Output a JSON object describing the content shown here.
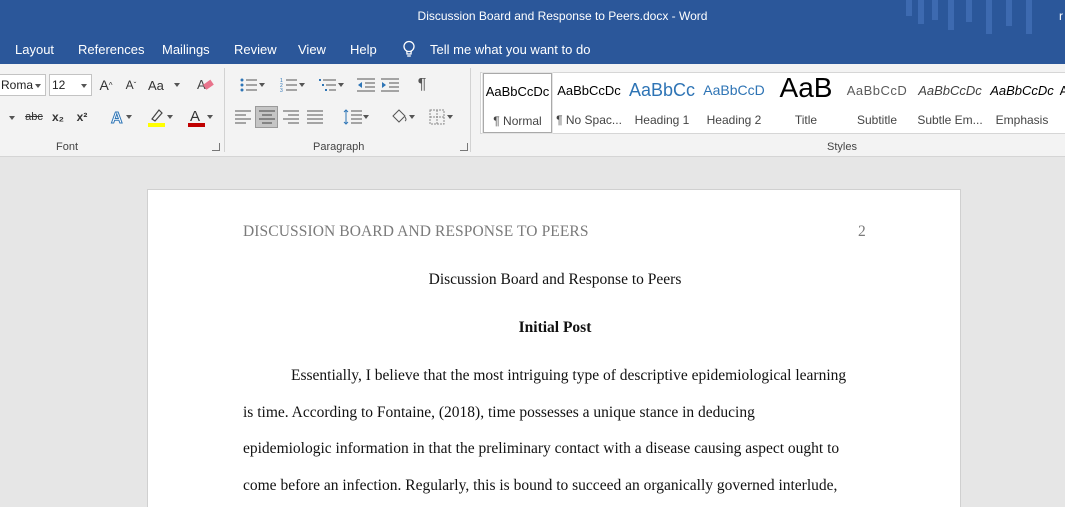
{
  "window": {
    "title": "Discussion Board and Response to Peers.docx  -  Word",
    "user_initial": "r"
  },
  "tabs": [
    {
      "label": "Layout"
    },
    {
      "label": "References"
    },
    {
      "label": "Mailings"
    },
    {
      "label": "Review"
    },
    {
      "label": "View"
    },
    {
      "label": "Help"
    }
  ],
  "tellme": {
    "label": "Tell me what you want to do",
    "icon": "lightbulb-icon"
  },
  "font_group": {
    "font_name": "Roma",
    "font_size": "12",
    "label": "Font",
    "grow_label": "A",
    "shrink_label": "A",
    "case_label": "Aa",
    "strike_label": "abc",
    "subscript_label": "x₂",
    "superscript_label": "x²",
    "font_color": "#c00000",
    "highlight_color": "#ffff00"
  },
  "paragraph_group": {
    "label": "Paragraph",
    "pilcrow": "¶",
    "alignment_selected": "center"
  },
  "styles_group": {
    "label": "Styles",
    "styles": [
      {
        "sample": "AaBbCcDc",
        "name": "¶ Normal"
      },
      {
        "sample": "AaBbCcDc",
        "name": "¶ No Spac..."
      },
      {
        "sample": "AaBbCc",
        "name": "Heading 1"
      },
      {
        "sample": "AaBbCcD",
        "name": "Heading 2"
      },
      {
        "sample": "AaB",
        "name": "Title"
      },
      {
        "sample": "AaBbCcD",
        "name": "Subtitle"
      },
      {
        "sample": "AaBbCcDc",
        "name": "Subtle Em..."
      },
      {
        "sample": "AaBbCcDc",
        "name": "Emphasis"
      }
    ]
  },
  "document": {
    "running_header": "DISCUSSION BOARD AND RESPONSE TO PEERS",
    "page_number": "2",
    "title": "Discussion Board and Response to Peers",
    "subtitle": "Initial Post",
    "lines": [
      "Essentially, I believe that the most intriguing type of descriptive epidemiological learning",
      "is time. According to Fontaine, (2018), time possesses a unique stance in deducing",
      "epidemiologic information in that the preliminary contact with a disease causing aspect ought to",
      "come before an infection. Regularly, this is bound to succeed an organically governed interlude,"
    ]
  }
}
